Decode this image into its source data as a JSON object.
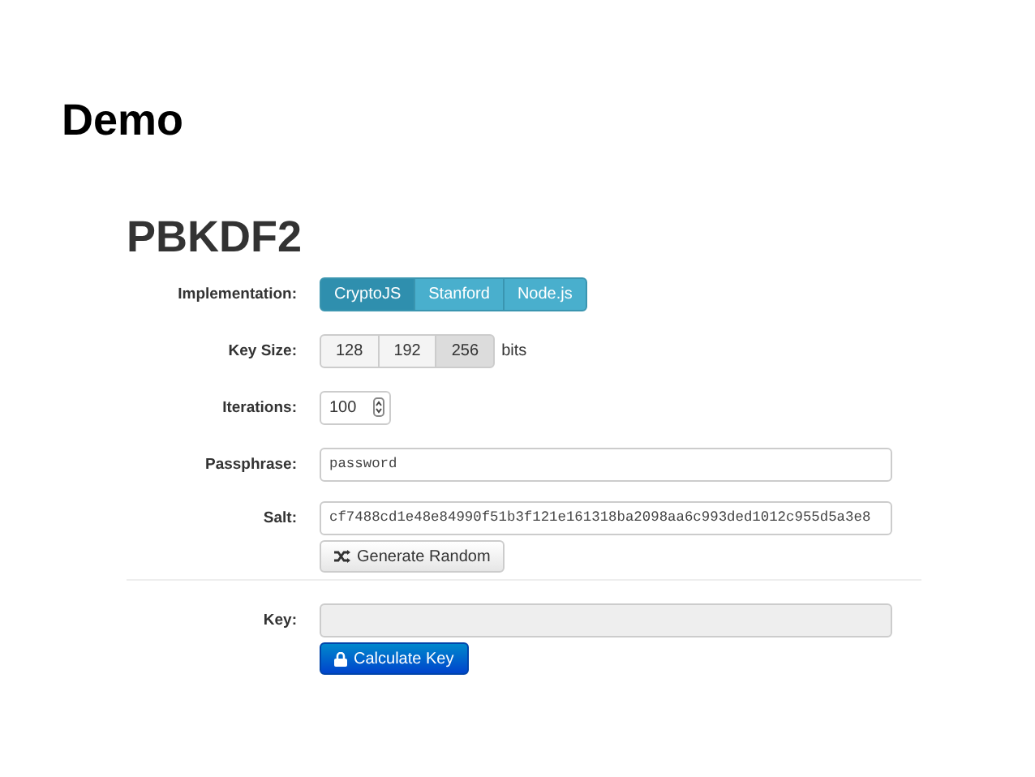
{
  "slide_title": "Demo",
  "heading": "PBKDF2",
  "implementation": {
    "label": "Implementation:",
    "options": [
      {
        "label": "CryptoJS",
        "selected": true
      },
      {
        "label": "Stanford",
        "selected": false
      },
      {
        "label": "Node.js",
        "selected": false
      }
    ]
  },
  "key_size": {
    "label": "Key Size:",
    "unit": "bits",
    "options": [
      {
        "label": "128",
        "selected": false
      },
      {
        "label": "192",
        "selected": false
      },
      {
        "label": "256",
        "selected": true
      }
    ]
  },
  "iterations": {
    "label": "Iterations:",
    "value": "100"
  },
  "passphrase": {
    "label": "Passphrase:",
    "value": "password"
  },
  "salt": {
    "label": "Salt:",
    "value": "cf7488cd1e48e84990f51b3f121e161318ba2098aa6c993ded1012c955d5a3e8"
  },
  "generate_button": "Generate Random",
  "key": {
    "label": "Key:",
    "disabled": true
  },
  "calculate_button": "Calculate Key"
}
